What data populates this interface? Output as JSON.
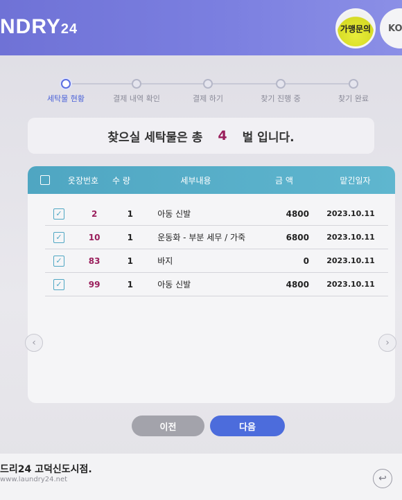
{
  "header": {
    "logo": "NDRY",
    "logo_suffix": "24",
    "inquiry_button": "가맹문의",
    "language_button": "KO"
  },
  "steps": [
    {
      "label": "세탁물 현황",
      "active": true
    },
    {
      "label": "결제 내역 확인",
      "active": false
    },
    {
      "label": "결제 하기",
      "active": false
    },
    {
      "label": "찾기 진행 중",
      "active": false
    },
    {
      "label": "찾기 완료",
      "active": false
    }
  ],
  "summary": {
    "prefix": "찾으실 세탁물은 총",
    "count": "4",
    "suffix": "벌 입니다."
  },
  "table": {
    "headers": {
      "number": "옷장번호",
      "qty": "수 량",
      "desc": "세부내용",
      "amount": "금 액",
      "date": "맡긴일자"
    },
    "rows": [
      {
        "checked": true,
        "number": "2",
        "qty": "1",
        "desc": "아동 신발",
        "amount": "4800",
        "date": "2023.10.11"
      },
      {
        "checked": true,
        "number": "10",
        "qty": "1",
        "desc": "운동화 - 부분 세무 / 가죽",
        "amount": "6800",
        "date": "2023.10.11"
      },
      {
        "checked": true,
        "number": "83",
        "qty": "1",
        "desc": "바지",
        "amount": "0",
        "date": "2023.10.11"
      },
      {
        "checked": true,
        "number": "99",
        "qty": "1",
        "desc": "아동 신발",
        "amount": "4800",
        "date": "2023.10.11"
      }
    ]
  },
  "buttons": {
    "prev": "이전",
    "next": "다음"
  },
  "footer": {
    "store": "드리24 고덕신도시점.",
    "site": "www.laundry24.net"
  },
  "icons": {
    "left_arrow": "chevron-left-icon",
    "right_arrow": "chevron-right-icon",
    "back": "back-icon"
  }
}
